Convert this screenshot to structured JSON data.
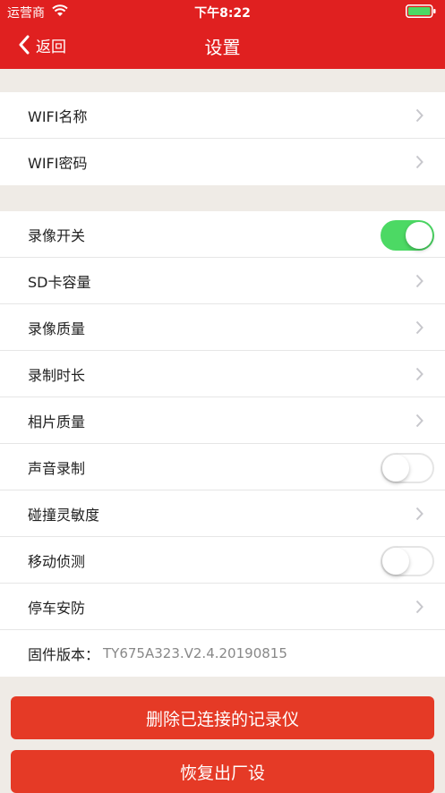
{
  "statusbar": {
    "carrier": "运营商",
    "time": "下午8:22"
  },
  "nav": {
    "back_label": "返回",
    "title": "设置"
  },
  "wifi_group": [
    {
      "label": "WIFI名称"
    },
    {
      "label": "WIFI密码"
    }
  ],
  "settings_group": [
    {
      "label": "录像开关",
      "control": "toggle",
      "on": true
    },
    {
      "label": "SD卡容量",
      "control": "chevron"
    },
    {
      "label": "录像质量",
      "control": "chevron"
    },
    {
      "label": "录制时长",
      "control": "chevron"
    },
    {
      "label": "相片质量",
      "control": "chevron"
    },
    {
      "label": "声音录制",
      "control": "toggle",
      "on": false
    },
    {
      "label": "碰撞灵敏度",
      "control": "chevron"
    },
    {
      "label": "移动侦测",
      "control": "toggle",
      "on": false
    },
    {
      "label": "停车安防",
      "control": "chevron"
    }
  ],
  "firmware": {
    "label": "固件版本：",
    "value": "TY675A323.V2.4.20190815"
  },
  "buttons": {
    "delete_label": "删除已连接的记录仪",
    "reset_label": "恢复出厂设"
  },
  "colors": {
    "brand_red": "#e02020",
    "button_red": "#e53a26",
    "toggle_on": "#4cd964"
  }
}
